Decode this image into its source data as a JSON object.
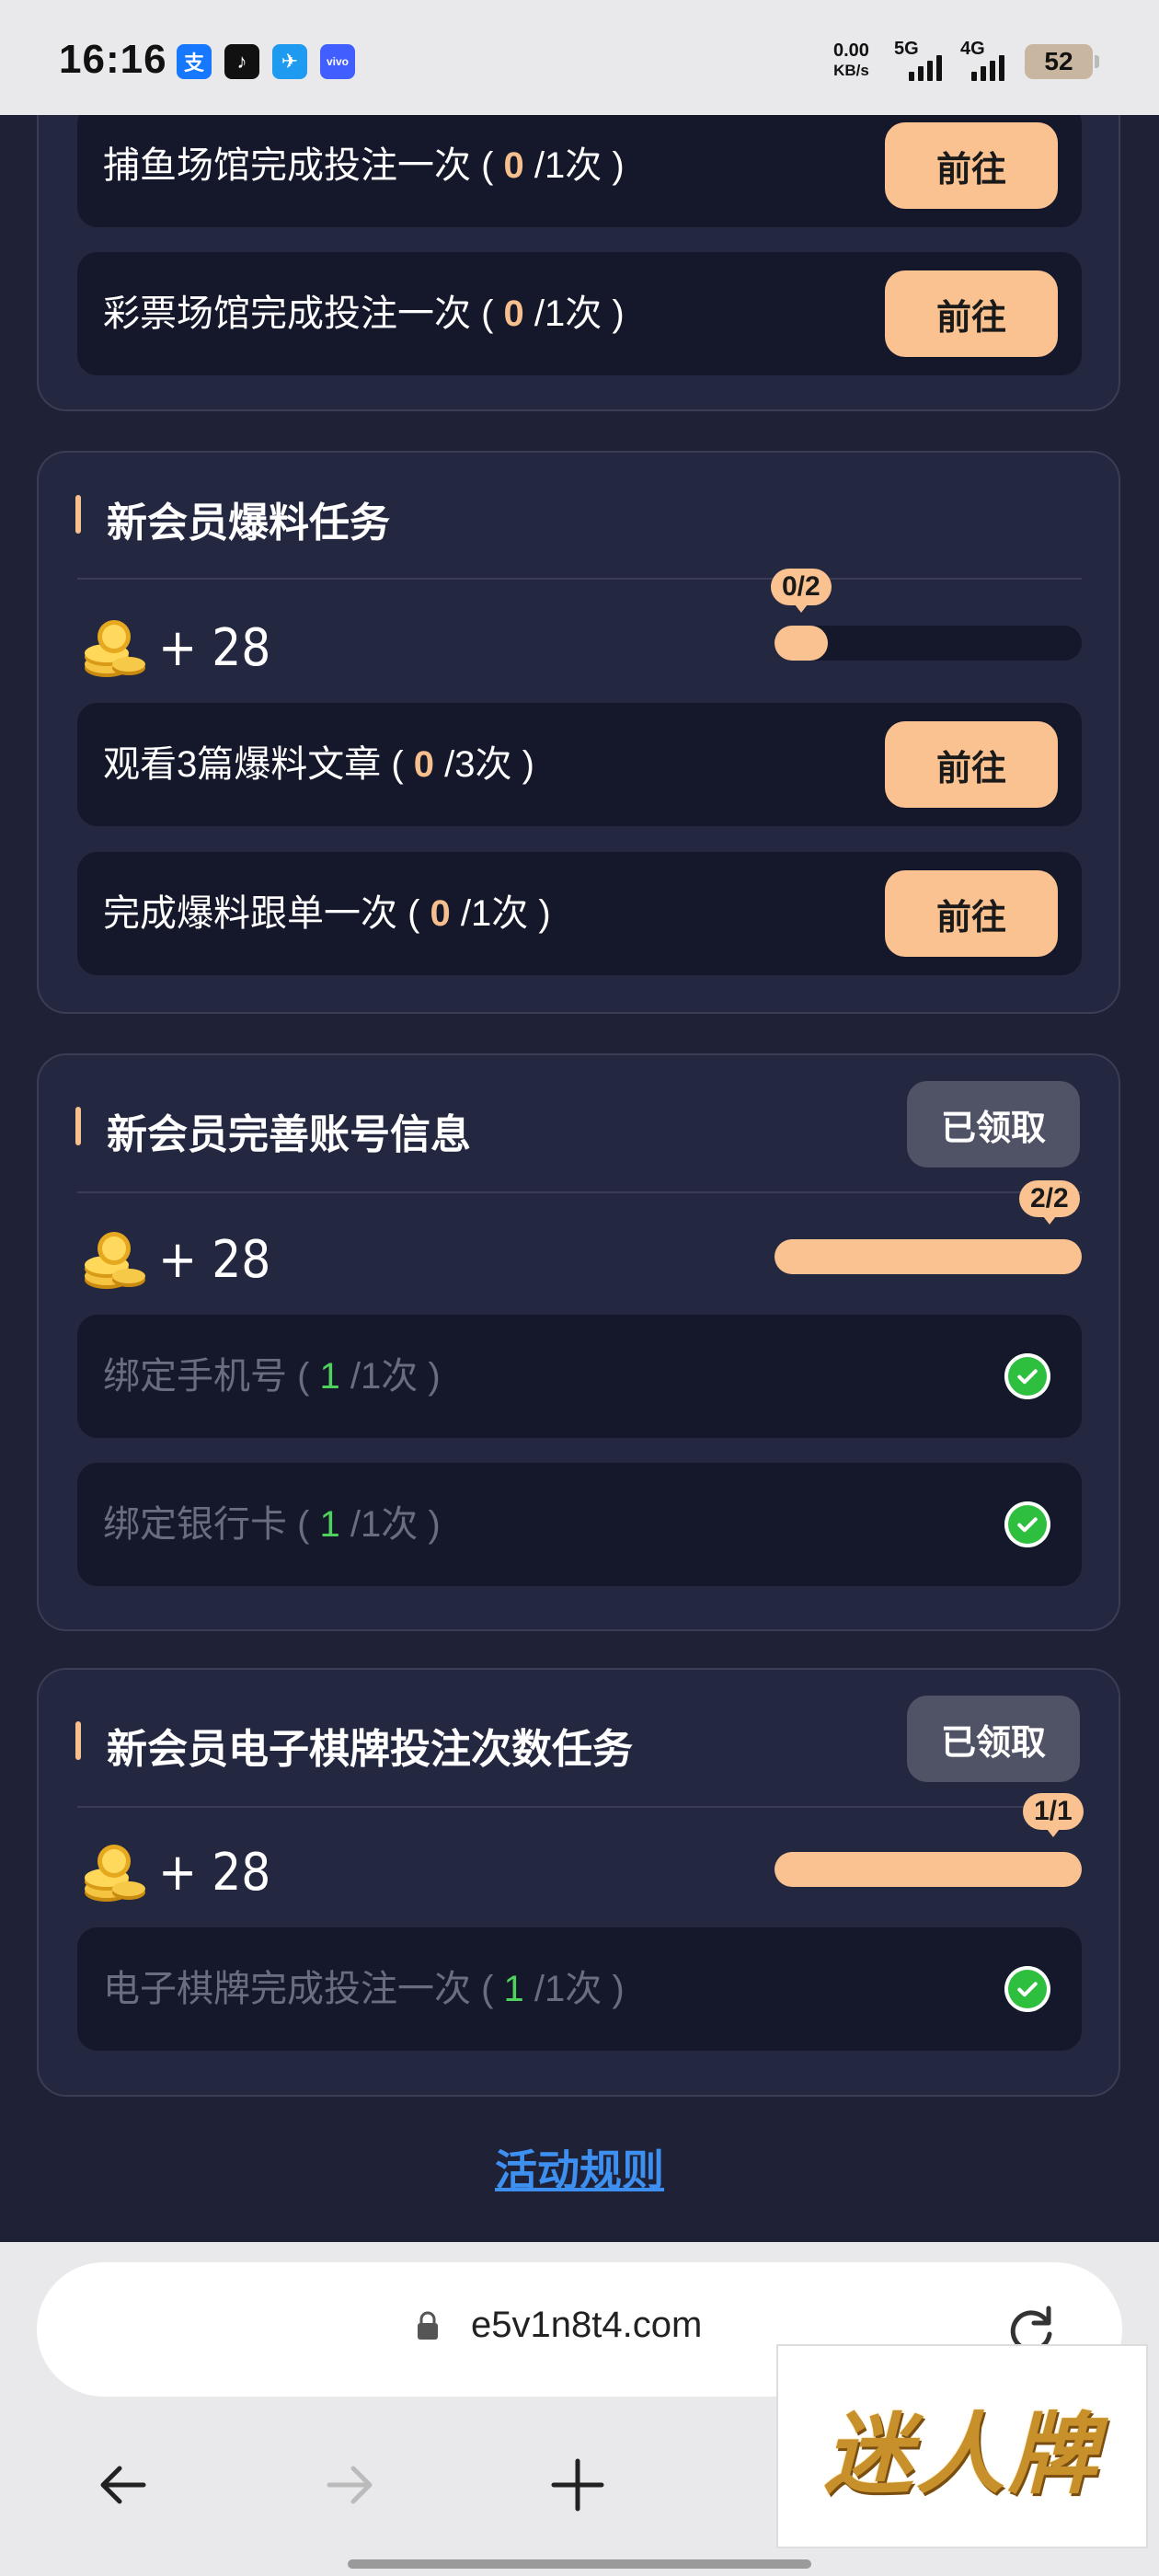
{
  "status_bar": {
    "time": "16:16",
    "apps": [
      {
        "icon": "alipay-icon",
        "glyph": "支",
        "color": "#1677ff"
      },
      {
        "icon": "tiktok-icon",
        "glyph": "♪",
        "color": "#111111"
      },
      {
        "icon": "bird-app-icon",
        "glyph": "✈",
        "color": "#1e9bf0"
      },
      {
        "icon": "vivo-icon",
        "glyph": "vivo",
        "color": "#415fff"
      }
    ],
    "net_speed_value": "0.00",
    "net_speed_unit": "KB/s",
    "net_5g": "5G",
    "net_4g": "4G",
    "battery": "52"
  },
  "sections": {
    "venue": {
      "tasks": [
        {
          "label_pre": "捕鱼场馆完成投注一次 ( ",
          "count": "0",
          "label_post": " /1次 )",
          "button": "前往"
        },
        {
          "label_pre": "彩票场馆完成投注一次 ( ",
          "count": "0",
          "label_post": " /1次 )",
          "button": "前往"
        }
      ]
    },
    "tips": {
      "title": "新会员爆料任务",
      "reward": "+ 28",
      "progress_label": "0/2",
      "progress": 0,
      "tasks": [
        {
          "label_pre": "观看3篇爆料文章 ( ",
          "count": "0",
          "label_post": " /3次 )",
          "button": "前往"
        },
        {
          "label_pre": "完成爆料跟单一次 ( ",
          "count": "0",
          "label_post": " /1次 )",
          "button": "前往"
        }
      ]
    },
    "account": {
      "title": "新会员完善账号信息",
      "claim_status": "已领取",
      "reward": "+ 28",
      "progress_label": "2/2",
      "progress": 1,
      "tasks": [
        {
          "label_pre": "绑定手机号 ( ",
          "count": "1",
          "label_post": " /1次 )"
        },
        {
          "label_pre": "绑定银行卡 ( ",
          "count": "1",
          "label_post": " /1次 )"
        }
      ]
    },
    "chess": {
      "title": "新会员电子棋牌投注次数任务",
      "claim_status": "已领取",
      "reward": "+ 28",
      "progress_label": "1/1",
      "progress": 1,
      "tasks": [
        {
          "label_pre": "电子棋牌完成投注一次 ( ",
          "count": "1",
          "label_post": " /1次 )"
        }
      ]
    }
  },
  "rules_link": "活动规则",
  "browser": {
    "url": "e5v1n8t4.com",
    "watermark": "迷人牌"
  },
  "colors": {
    "accent": "#f9c290",
    "success": "#2fbf3e",
    "link": "#3d8ff0",
    "background": "#1f2236"
  }
}
